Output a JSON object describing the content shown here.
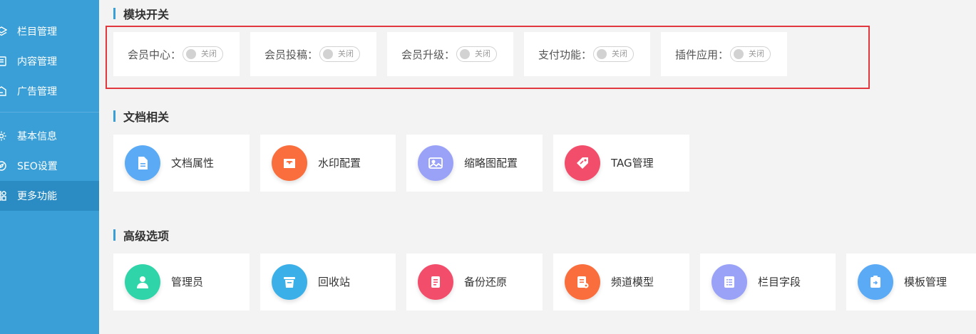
{
  "sidebar": {
    "items": [
      {
        "label": "栏目管理",
        "icon": "layers-icon"
      },
      {
        "label": "内容管理",
        "icon": "document-list-icon"
      },
      {
        "label": "广告管理",
        "icon": "ad-icon"
      },
      {
        "label": "基本信息",
        "icon": "gear-icon"
      },
      {
        "label": "SEO设置",
        "icon": "compass-icon"
      },
      {
        "label": "更多功能",
        "icon": "grid-icon"
      }
    ]
  },
  "module_switch": {
    "title": "模块开关",
    "items": [
      {
        "label": "会员中心：",
        "state": "关闭"
      },
      {
        "label": "会员投稿：",
        "state": "关闭"
      },
      {
        "label": "会员升级：",
        "state": "关闭"
      },
      {
        "label": "支付功能：",
        "state": "关闭"
      },
      {
        "label": "插件应用：",
        "state": "关闭"
      }
    ]
  },
  "document": {
    "title": "文档相关",
    "items": [
      {
        "label": "文档属性",
        "icon": "file-icon",
        "color": "#5aaaf5"
      },
      {
        "label": "水印配置",
        "icon": "inbox-icon",
        "color": "#f96e3c"
      },
      {
        "label": "缩略图配置",
        "icon": "image-icon",
        "color": "#9aa2f8"
      },
      {
        "label": "TAG管理",
        "icon": "tag-icon",
        "color": "#f24d6b"
      }
    ]
  },
  "advanced": {
    "title": "高级选项",
    "items": [
      {
        "label": "管理员",
        "icon": "user-icon",
        "color": "#2fd4a9"
      },
      {
        "label": "回收站",
        "icon": "trash-icon",
        "color": "#3bb0e8"
      },
      {
        "label": "备份还原",
        "icon": "backup-icon",
        "color": "#f24d6b"
      },
      {
        "label": "频道模型",
        "icon": "channel-model-icon",
        "color": "#f96e3c"
      },
      {
        "label": "栏目字段",
        "icon": "field-list-icon",
        "color": "#9aa2f8"
      },
      {
        "label": "模板管理",
        "icon": "clipboard-icon",
        "color": "#5aaaf5"
      }
    ]
  },
  "colors": {
    "sidebar": "#3a9fd6",
    "sidebar_active": "#2b8bc3",
    "highlight_frame": "#e0383e"
  }
}
